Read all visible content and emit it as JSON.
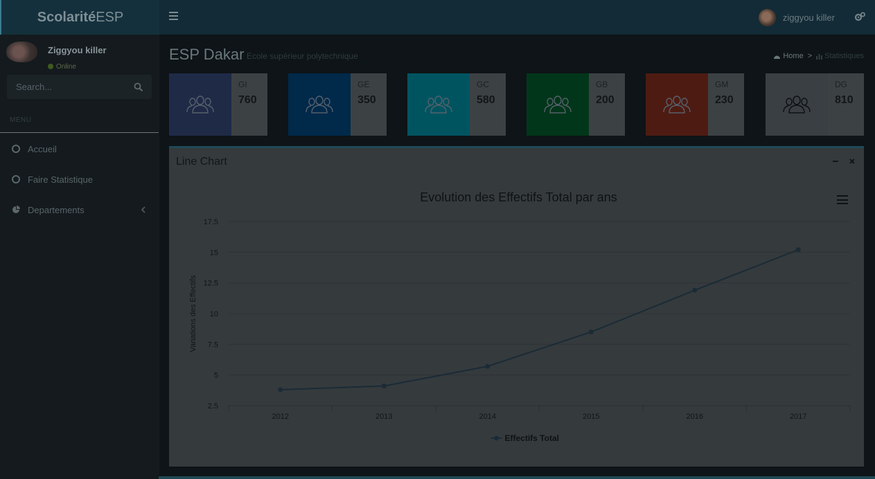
{
  "app": {
    "logo_bold": "Scolarité",
    "logo_rest": "ESP"
  },
  "header": {
    "user_name": "ziggyou killer",
    "icons": {
      "menu": "hamburger-icon",
      "settings": "gears-icon"
    }
  },
  "sidebar": {
    "user_name": "Ziggyou killer",
    "status": "Online",
    "search_placeholder": "Search...",
    "menu_header": "MENU",
    "items": [
      {
        "label": "Accueil",
        "icon": "circle-icon"
      },
      {
        "label": "Faire Statistique",
        "icon": "circle-icon"
      },
      {
        "label": "Departements",
        "icon": "pie-chart-icon",
        "expandable": true
      }
    ]
  },
  "content": {
    "title": "ESP Dakar",
    "subtitle": "Ecole supérieur polytechnique",
    "breadcrumb": [
      {
        "label": "Home",
        "icon": "dashboard-icon"
      },
      {
        "label": "Statistiques",
        "icon": "chart-icon"
      }
    ],
    "breadcrumb_sep": ">"
  },
  "info_boxes": [
    {
      "label": "GI",
      "value": "760",
      "color": "#1f2a47"
    },
    {
      "label": "GE",
      "value": "350",
      "color": "#00294a"
    },
    {
      "label": "GC",
      "value": "580",
      "color": "#005460"
    },
    {
      "label": "GB",
      "value": "200",
      "color": "#02361a"
    },
    {
      "label": "GM",
      "value": "230",
      "color": "#4e1b12"
    },
    {
      "label": "DG",
      "value": "810",
      "color": "#3a3f43"
    }
  ],
  "chart_box": {
    "title": "Line Chart",
    "tools": [
      "minimize-icon",
      "close-icon"
    ]
  },
  "chart_data": {
    "type": "line",
    "title": "Evolution des Effectifs Total par ans",
    "xlabel": "",
    "ylabel": "Variations des Effectifs",
    "categories": [
      "2012",
      "2013",
      "2014",
      "2015",
      "2016",
      "2017"
    ],
    "series": [
      {
        "name": "Effectifs Total",
        "values": [
          3.8,
          4.1,
          5.7,
          8.5,
          11.9,
          15.2
        ],
        "color": "#1a2b36"
      }
    ],
    "y_ticks": [
      "2.5",
      "5",
      "7.5",
      "10",
      "12.5",
      "15",
      "17.5"
    ],
    "ylim": [
      2.5,
      17.5
    ],
    "grid": true,
    "legend_position": "bottom"
  }
}
